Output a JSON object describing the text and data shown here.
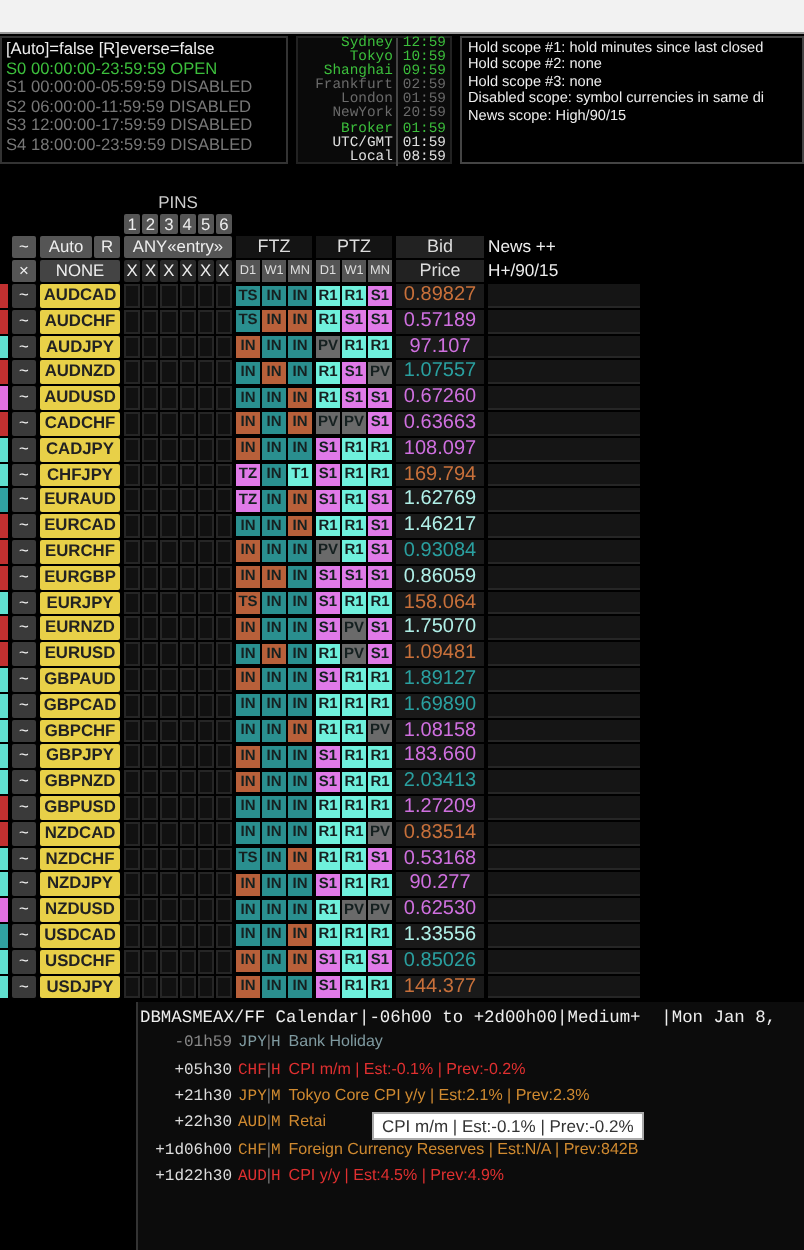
{
  "sessions": [
    {
      "text": "[Auto]=false [R]everse=false",
      "kind": "title"
    },
    {
      "text": "S0 00:00:00-23:59:59 OPEN",
      "kind": "session",
      "open": true
    },
    {
      "text": "S1 00:00:00-05:59:59 DISABLED",
      "kind": "session",
      "open": false
    },
    {
      "text": "S2 06:00:00-11:59:59 DISABLED",
      "kind": "session",
      "open": false
    },
    {
      "text": "S3 12:00:00-17:59:59 DISABLED",
      "kind": "session",
      "open": false
    },
    {
      "text": "S4 18:00:00-23:59:59 DISABLED",
      "kind": "session",
      "open": false
    }
  ],
  "clocks": [
    {
      "city": "Sydney",
      "time": "12:59",
      "color": "#3cbf3c"
    },
    {
      "city": "Tokyo",
      "time": "10:59",
      "color": "#3cbf3c"
    },
    {
      "city": "Shanghai",
      "time": "09:59",
      "color": "#3cbf3c"
    },
    {
      "city": "Frankfurt",
      "time": "02:59",
      "color": "#6a6a6a"
    },
    {
      "city": "London",
      "time": "01:59",
      "color": "#6a6a6a"
    },
    {
      "city": "NewYork",
      "time": "20:59",
      "color": "#6a6a6a"
    },
    {
      "city": "Broker",
      "time": "01:59",
      "color": "#3cbf3c"
    },
    {
      "city": "UTC/GMT",
      "time": "01:59",
      "color": "#e0e0e0"
    },
    {
      "city": "Local",
      "time": "08:59",
      "color": "#e0e0e0"
    }
  ],
  "scopes": [
    "Hold scope #1: hold minutes since last closed",
    "Hold scope #2: none",
    "Hold scope #3: none",
    "Disabled scope: symbol currencies in same di",
    "News scope: High/90/15"
  ],
  "header": {
    "pins_label": "PINS",
    "pin_numbers": [
      "1",
      "2",
      "3",
      "4",
      "5",
      "6"
    ],
    "toggle": "~",
    "auto": "Auto",
    "reverse": "R",
    "any_entry": "ANY«entry»",
    "ftz": "FTZ",
    "ptz": "PTZ",
    "bid": "Bid",
    "news": "News ++",
    "close": "×",
    "none": "NONE",
    "pin_clear": [
      "X",
      "X",
      "X",
      "X",
      "X",
      "X"
    ],
    "ftz_periods": [
      "D1",
      "W1",
      "MN"
    ],
    "ptz_periods": [
      "D1",
      "W1",
      "MN"
    ],
    "price": "Price",
    "news_filter": "H+/90/15"
  },
  "rows": [
    {
      "color": "#c03030",
      "toggle": "~",
      "pair": "AUDCAD",
      "ftz": [
        {
          "text": "TS",
          "color": "#2a8f8f"
        },
        {
          "text": "IN",
          "color": "#2a8f8f"
        },
        {
          "text": "IN",
          "color": "#2a8f8f"
        }
      ],
      "ptz": [
        {
          "text": "R1",
          "color": "#6ff0dc"
        },
        {
          "text": "R1",
          "color": "#6ff0dc"
        },
        {
          "text": "S1",
          "color": "#e07ae8"
        }
      ],
      "price": {
        "text": "0.89827",
        "color": "#c8703a"
      }
    },
    {
      "color": "#c03030",
      "toggle": "~",
      "pair": "AUDCHF",
      "ftz": [
        {
          "text": "TS",
          "color": "#2a8f8f"
        },
        {
          "text": "IN",
          "color": "#b8603a"
        },
        {
          "text": "IN",
          "color": "#b8603a"
        }
      ],
      "ptz": [
        {
          "text": "R1",
          "color": "#6ff0dc"
        },
        {
          "text": "S1",
          "color": "#e07ae8"
        },
        {
          "text": "S1",
          "color": "#e07ae8"
        }
      ],
      "price": {
        "text": "0.57189",
        "color": "#d070e0"
      }
    },
    {
      "color": "#60e0d0",
      "toggle": "~",
      "pair": "AUDJPY",
      "ftz": [
        {
          "text": "IN",
          "color": "#b8603a"
        },
        {
          "text": "IN",
          "color": "#2a8f8f"
        },
        {
          "text": "IN",
          "color": "#2a8f8f"
        }
      ],
      "ptz": [
        {
          "text": "PV",
          "color": "#6a6a6a"
        },
        {
          "text": "R1",
          "color": "#6ff0dc"
        },
        {
          "text": "R1",
          "color": "#6ff0dc"
        }
      ],
      "price": {
        "text": "97.107",
        "color": "#d070e0"
      }
    },
    {
      "color": "#c03030",
      "toggle": "~",
      "pair": "AUDNZD",
      "ftz": [
        {
          "text": "IN",
          "color": "#2a8f8f"
        },
        {
          "text": "IN",
          "color": "#b8603a"
        },
        {
          "text": "IN",
          "color": "#2a8f8f"
        }
      ],
      "ptz": [
        {
          "text": "R1",
          "color": "#6ff0dc"
        },
        {
          "text": "S1",
          "color": "#e07ae8"
        },
        {
          "text": "PV",
          "color": "#6a6a6a"
        }
      ],
      "price": {
        "text": "1.07557",
        "color": "#2aa0a0"
      }
    },
    {
      "color": "#e070e0",
      "toggle": "~",
      "pair": "AUDUSD",
      "ftz": [
        {
          "text": "IN",
          "color": "#2a8f8f"
        },
        {
          "text": "IN",
          "color": "#2a8f8f"
        },
        {
          "text": "IN",
          "color": "#b8603a"
        }
      ],
      "ptz": [
        {
          "text": "R1",
          "color": "#6ff0dc"
        },
        {
          "text": "S1",
          "color": "#e07ae8"
        },
        {
          "text": "S1",
          "color": "#e07ae8"
        }
      ],
      "price": {
        "text": "0.67260",
        "color": "#d070e0"
      }
    },
    {
      "color": "#c03030",
      "toggle": "~",
      "pair": "CADCHF",
      "ftz": [
        {
          "text": "IN",
          "color": "#b8603a"
        },
        {
          "text": "IN",
          "color": "#2a8f8f"
        },
        {
          "text": "IN",
          "color": "#b8603a"
        }
      ],
      "ptz": [
        {
          "text": "PV",
          "color": "#6a6a6a"
        },
        {
          "text": "PV",
          "color": "#6a6a6a"
        },
        {
          "text": "S1",
          "color": "#e07ae8"
        }
      ],
      "price": {
        "text": "0.63663",
        "color": "#d070e0"
      }
    },
    {
      "color": "#60e0d0",
      "toggle": "~",
      "pair": "CADJPY",
      "ftz": [
        {
          "text": "IN",
          "color": "#b8603a"
        },
        {
          "text": "IN",
          "color": "#2a8f8f"
        },
        {
          "text": "IN",
          "color": "#2a8f8f"
        }
      ],
      "ptz": [
        {
          "text": "S1",
          "color": "#e07ae8"
        },
        {
          "text": "R1",
          "color": "#6ff0dc"
        },
        {
          "text": "R1",
          "color": "#6ff0dc"
        }
      ],
      "price": {
        "text": "108.097",
        "color": "#d070e0"
      }
    },
    {
      "color": "#60e0d0",
      "toggle": "~",
      "pair": "CHFJPY",
      "ftz": [
        {
          "text": "TZ",
          "color": "#e07ae8"
        },
        {
          "text": "IN",
          "color": "#2a8f8f"
        },
        {
          "text": "T1",
          "color": "#6ff0dc"
        }
      ],
      "ptz": [
        {
          "text": "S1",
          "color": "#e07ae8"
        },
        {
          "text": "R1",
          "color": "#6ff0dc"
        },
        {
          "text": "R1",
          "color": "#6ff0dc"
        }
      ],
      "price": {
        "text": "169.794",
        "color": "#c8703a"
      }
    },
    {
      "color": "#30a0a0",
      "toggle": "~",
      "pair": "EURAUD",
      "ftz": [
        {
          "text": "TZ",
          "color": "#e07ae8"
        },
        {
          "text": "IN",
          "color": "#2a8f8f"
        },
        {
          "text": "IN",
          "color": "#b8603a"
        }
      ],
      "ptz": [
        {
          "text": "S1",
          "color": "#e07ae8"
        },
        {
          "text": "R1",
          "color": "#6ff0dc"
        },
        {
          "text": "S1",
          "color": "#e07ae8"
        }
      ],
      "price": {
        "text": "1.62769",
        "color": "#b0f0e8"
      }
    },
    {
      "color": "#c03030",
      "toggle": "~",
      "pair": "EURCAD",
      "ftz": [
        {
          "text": "IN",
          "color": "#2a8f8f"
        },
        {
          "text": "IN",
          "color": "#2a8f8f"
        },
        {
          "text": "IN",
          "color": "#b8603a"
        }
      ],
      "ptz": [
        {
          "text": "R1",
          "color": "#6ff0dc"
        },
        {
          "text": "R1",
          "color": "#6ff0dc"
        },
        {
          "text": "S1",
          "color": "#e07ae8"
        }
      ],
      "price": {
        "text": "1.46217",
        "color": "#b0f0e8"
      }
    },
    {
      "color": "#c03030",
      "toggle": "~",
      "pair": "EURCHF",
      "ftz": [
        {
          "text": "IN",
          "color": "#b8603a"
        },
        {
          "text": "IN",
          "color": "#2a8f8f"
        },
        {
          "text": "IN",
          "color": "#2a8f8f"
        }
      ],
      "ptz": [
        {
          "text": "PV",
          "color": "#6a6a6a"
        },
        {
          "text": "R1",
          "color": "#6ff0dc"
        },
        {
          "text": "S1",
          "color": "#e07ae8"
        }
      ],
      "price": {
        "text": "0.93084",
        "color": "#2aa0a0"
      }
    },
    {
      "color": "#c03030",
      "toggle": "~",
      "pair": "EURGBP",
      "ftz": [
        {
          "text": "IN",
          "color": "#b8603a"
        },
        {
          "text": "IN",
          "color": "#b8603a"
        },
        {
          "text": "IN",
          "color": "#2a8f8f"
        }
      ],
      "ptz": [
        {
          "text": "S1",
          "color": "#e07ae8"
        },
        {
          "text": "S1",
          "color": "#e07ae8"
        },
        {
          "text": "S1",
          "color": "#e07ae8"
        }
      ],
      "price": {
        "text": "0.86059",
        "color": "#b0f0e8"
      }
    },
    {
      "color": "#60e0d0",
      "toggle": "~",
      "pair": "EURJPY",
      "ftz": [
        {
          "text": "TS",
          "color": "#b8603a"
        },
        {
          "text": "IN",
          "color": "#2a8f8f"
        },
        {
          "text": "IN",
          "color": "#2a8f8f"
        }
      ],
      "ptz": [
        {
          "text": "S1",
          "color": "#e07ae8"
        },
        {
          "text": "R1",
          "color": "#6ff0dc"
        },
        {
          "text": "R1",
          "color": "#6ff0dc"
        }
      ],
      "price": {
        "text": "158.064",
        "color": "#c8703a"
      }
    },
    {
      "color": "#c03030",
      "toggle": "~",
      "pair": "EURNZD",
      "ftz": [
        {
          "text": "IN",
          "color": "#b8603a"
        },
        {
          "text": "IN",
          "color": "#2a8f8f"
        },
        {
          "text": "IN",
          "color": "#2a8f8f"
        }
      ],
      "ptz": [
        {
          "text": "S1",
          "color": "#e07ae8"
        },
        {
          "text": "PV",
          "color": "#6a6a6a"
        },
        {
          "text": "S1",
          "color": "#e07ae8"
        }
      ],
      "price": {
        "text": "1.75070",
        "color": "#b0f0e8"
      }
    },
    {
      "color": "#c03030",
      "toggle": "~",
      "pair": "EURUSD",
      "ftz": [
        {
          "text": "IN",
          "color": "#2a8f8f"
        },
        {
          "text": "IN",
          "color": "#b8603a"
        },
        {
          "text": "IN",
          "color": "#2a8f8f"
        }
      ],
      "ptz": [
        {
          "text": "R1",
          "color": "#6ff0dc"
        },
        {
          "text": "PV",
          "color": "#6a6a6a"
        },
        {
          "text": "S1",
          "color": "#e07ae8"
        }
      ],
      "price": {
        "text": "1.09481",
        "color": "#c8703a"
      }
    },
    {
      "color": "#60e0d0",
      "toggle": "~",
      "pair": "GBPAUD",
      "ftz": [
        {
          "text": "IN",
          "color": "#b8603a"
        },
        {
          "text": "IN",
          "color": "#2a8f8f"
        },
        {
          "text": "IN",
          "color": "#2a8f8f"
        }
      ],
      "ptz": [
        {
          "text": "S1",
          "color": "#e07ae8"
        },
        {
          "text": "R1",
          "color": "#6ff0dc"
        },
        {
          "text": "R1",
          "color": "#6ff0dc"
        }
      ],
      "price": {
        "text": "1.89127",
        "color": "#2aa0a0"
      }
    },
    {
      "color": "#60e0d0",
      "toggle": "~",
      "pair": "GBPCAD",
      "ftz": [
        {
          "text": "IN",
          "color": "#2a8f8f"
        },
        {
          "text": "IN",
          "color": "#2a8f8f"
        },
        {
          "text": "IN",
          "color": "#2a8f8f"
        }
      ],
      "ptz": [
        {
          "text": "R1",
          "color": "#6ff0dc"
        },
        {
          "text": "R1",
          "color": "#6ff0dc"
        },
        {
          "text": "R1",
          "color": "#6ff0dc"
        }
      ],
      "price": {
        "text": "1.69890",
        "color": "#2aa0a0"
      }
    },
    {
      "color": "#60e0d0",
      "toggle": "~",
      "pair": "GBPCHF",
      "ftz": [
        {
          "text": "IN",
          "color": "#2a8f8f"
        },
        {
          "text": "IN",
          "color": "#2a8f8f"
        },
        {
          "text": "IN",
          "color": "#b8603a"
        }
      ],
      "ptz": [
        {
          "text": "R1",
          "color": "#6ff0dc"
        },
        {
          "text": "R1",
          "color": "#6ff0dc"
        },
        {
          "text": "PV",
          "color": "#6a6a6a"
        }
      ],
      "price": {
        "text": "1.08158",
        "color": "#d070e0"
      }
    },
    {
      "color": "#60e0d0",
      "toggle": "~",
      "pair": "GBPJPY",
      "ftz": [
        {
          "text": "IN",
          "color": "#b8603a"
        },
        {
          "text": "IN",
          "color": "#2a8f8f"
        },
        {
          "text": "IN",
          "color": "#2a8f8f"
        }
      ],
      "ptz": [
        {
          "text": "S1",
          "color": "#e07ae8"
        },
        {
          "text": "R1",
          "color": "#6ff0dc"
        },
        {
          "text": "R1",
          "color": "#6ff0dc"
        }
      ],
      "price": {
        "text": "183.660",
        "color": "#d070e0"
      }
    },
    {
      "color": "#60e0d0",
      "toggle": "~",
      "pair": "GBPNZD",
      "ftz": [
        {
          "text": "IN",
          "color": "#b8603a"
        },
        {
          "text": "IN",
          "color": "#2a8f8f"
        },
        {
          "text": "IN",
          "color": "#2a8f8f"
        }
      ],
      "ptz": [
        {
          "text": "S1",
          "color": "#e07ae8"
        },
        {
          "text": "R1",
          "color": "#6ff0dc"
        },
        {
          "text": "R1",
          "color": "#6ff0dc"
        }
      ],
      "price": {
        "text": "2.03413",
        "color": "#2aa0a0"
      }
    },
    {
      "color": "#c03030",
      "toggle": "~",
      "pair": "GBPUSD",
      "ftz": [
        {
          "text": "IN",
          "color": "#2a8f8f"
        },
        {
          "text": "IN",
          "color": "#2a8f8f"
        },
        {
          "text": "IN",
          "color": "#2a8f8f"
        }
      ],
      "ptz": [
        {
          "text": "R1",
          "color": "#6ff0dc"
        },
        {
          "text": "R1",
          "color": "#6ff0dc"
        },
        {
          "text": "R1",
          "color": "#6ff0dc"
        }
      ],
      "price": {
        "text": "1.27209",
        "color": "#d070e0"
      }
    },
    {
      "color": "#c03030",
      "toggle": "~",
      "pair": "NZDCAD",
      "ftz": [
        {
          "text": "IN",
          "color": "#2a8f8f"
        },
        {
          "text": "IN",
          "color": "#2a8f8f"
        },
        {
          "text": "IN",
          "color": "#2a8f8f"
        }
      ],
      "ptz": [
        {
          "text": "R1",
          "color": "#6ff0dc"
        },
        {
          "text": "R1",
          "color": "#6ff0dc"
        },
        {
          "text": "PV",
          "color": "#6a6a6a"
        }
      ],
      "price": {
        "text": "0.83514",
        "color": "#c8703a"
      }
    },
    {
      "color": "#60e0d0",
      "toggle": "~",
      "pair": "NZDCHF",
      "ftz": [
        {
          "text": "TS",
          "color": "#2a8f8f"
        },
        {
          "text": "IN",
          "color": "#2a8f8f"
        },
        {
          "text": "IN",
          "color": "#b8603a"
        }
      ],
      "ptz": [
        {
          "text": "R1",
          "color": "#6ff0dc"
        },
        {
          "text": "R1",
          "color": "#6ff0dc"
        },
        {
          "text": "S1",
          "color": "#e07ae8"
        }
      ],
      "price": {
        "text": "0.53168",
        "color": "#d070e0"
      }
    },
    {
      "color": "#60e0d0",
      "toggle": "~",
      "pair": "NZDJPY",
      "ftz": [
        {
          "text": "IN",
          "color": "#b8603a"
        },
        {
          "text": "IN",
          "color": "#2a8f8f"
        },
        {
          "text": "IN",
          "color": "#2a8f8f"
        }
      ],
      "ptz": [
        {
          "text": "S1",
          "color": "#e07ae8"
        },
        {
          "text": "R1",
          "color": "#6ff0dc"
        },
        {
          "text": "R1",
          "color": "#6ff0dc"
        }
      ],
      "price": {
        "text": "90.277",
        "color": "#d070e0"
      }
    },
    {
      "color": "#e070e0",
      "toggle": "~",
      "pair": "NZDUSD",
      "ftz": [
        {
          "text": "IN",
          "color": "#2a8f8f"
        },
        {
          "text": "IN",
          "color": "#2a8f8f"
        },
        {
          "text": "IN",
          "color": "#2a8f8f"
        }
      ],
      "ptz": [
        {
          "text": "R1",
          "color": "#6ff0dc"
        },
        {
          "text": "PV",
          "color": "#6a6a6a"
        },
        {
          "text": "PV",
          "color": "#6a6a6a"
        }
      ],
      "price": {
        "text": "0.62530",
        "color": "#d070e0"
      }
    },
    {
      "color": "#30a0a0",
      "toggle": "~",
      "pair": "USDCAD",
      "ftz": [
        {
          "text": "IN",
          "color": "#2a8f8f"
        },
        {
          "text": "IN",
          "color": "#2a8f8f"
        },
        {
          "text": "IN",
          "color": "#b8603a"
        }
      ],
      "ptz": [
        {
          "text": "R1",
          "color": "#6ff0dc"
        },
        {
          "text": "R1",
          "color": "#6ff0dc"
        },
        {
          "text": "R1",
          "color": "#6ff0dc"
        }
      ],
      "price": {
        "text": "1.33556",
        "color": "#b0f0e8"
      }
    },
    {
      "color": "#60e0d0",
      "toggle": "~",
      "pair": "USDCHF",
      "ftz": [
        {
          "text": "IN",
          "color": "#b8603a"
        },
        {
          "text": "IN",
          "color": "#2a8f8f"
        },
        {
          "text": "IN",
          "color": "#b8603a"
        }
      ],
      "ptz": [
        {
          "text": "S1",
          "color": "#e07ae8"
        },
        {
          "text": "R1",
          "color": "#6ff0dc"
        },
        {
          "text": "S1",
          "color": "#e07ae8"
        }
      ],
      "price": {
        "text": "0.85026",
        "color": "#2aa0a0"
      }
    },
    {
      "color": "#60e0d0",
      "toggle": "~",
      "pair": "USDJPY",
      "ftz": [
        {
          "text": "IN",
          "color": "#b8603a"
        },
        {
          "text": "IN",
          "color": "#2a8f8f"
        },
        {
          "text": "IN",
          "color": "#2a8f8f"
        }
      ],
      "ptz": [
        {
          "text": "S1",
          "color": "#e07ae8"
        },
        {
          "text": "R1",
          "color": "#6ff0dc"
        },
        {
          "text": "R1",
          "color": "#6ff0dc"
        }
      ],
      "price": {
        "text": "144.377",
        "color": "#c8703a"
      }
    }
  ],
  "calendar": {
    "title": "DBMASMEAX/FF Calendar|-06h00 to +2d00h00|Medium+  |Mon Jan 8,",
    "events": [
      {
        "time": "-01h59",
        "currency": "JPY",
        "separator": "|",
        "impact": "H",
        "text": "Bank Holiday",
        "color": "#7f9aa0"
      },
      {
        "time": "+05h30",
        "currency": "CHF",
        "separator": "|",
        "impact": "H",
        "text": "CPI m/m | Est:-0.1% | Prev:-0.2%",
        "color": "#e03030"
      },
      {
        "time": "+21h30",
        "currency": "JPY",
        "separator": "|",
        "impact": "M",
        "text": "Tokyo Core CPI y/y | Est:2.1% | Prev:2.3%",
        "color": "#d08a30"
      },
      {
        "time": "+22h30",
        "currency": "AUD",
        "separator": "|",
        "impact": "M",
        "text": "Retai",
        "color": "#d08a30"
      },
      {
        "time": "+1d06h00",
        "currency": "CHF",
        "separator": "|",
        "impact": "M",
        "text": "Foreign Currency Reserves | Est:N/A | Prev:842B",
        "color": "#d08a30"
      },
      {
        "time": "+1d22h30",
        "currency": "AUD",
        "separator": "|",
        "impact": "H",
        "text": "CPI y/y | Est:4.5% | Prev:4.9%",
        "color": "#e03030"
      }
    ],
    "tooltip": "CPI m/m | Est:-0.1% | Prev:-0.2%"
  }
}
